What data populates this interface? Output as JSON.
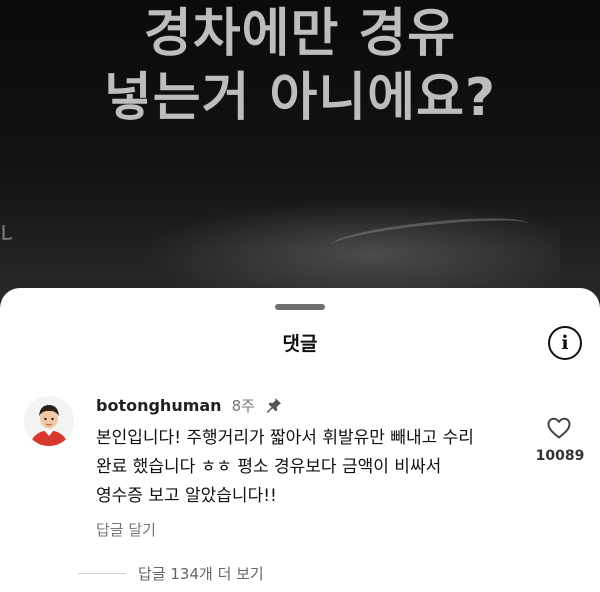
{
  "video": {
    "title_line1": "경차에만 경유",
    "title_line2": "넣는거 아니에요?",
    "edge_char": "내"
  },
  "sheet": {
    "title": "댓글"
  },
  "icons": {
    "info": "info-icon",
    "pin": "pin-icon",
    "like": "heart-icon",
    "avatar": "user-avatar"
  },
  "comment": {
    "username": "botonghuman",
    "timestamp": "8주",
    "lines": [
      "본인입니다! 주행거리가 짧아서 휘발유만 빼내고 수리",
      "완료 했습니다 ㅎㅎ 평소 경유보다 금액이 비싸서",
      "영수증 보고 알았습니다!!"
    ],
    "reply_label": "답글 달기",
    "like_count": "10089",
    "view_replies": "답글 134개 더 보기"
  },
  "colors": {
    "sheet_bg": "#ffffff",
    "avatar_shirt": "#d8372f",
    "video_bg": "#0b0b0b"
  }
}
